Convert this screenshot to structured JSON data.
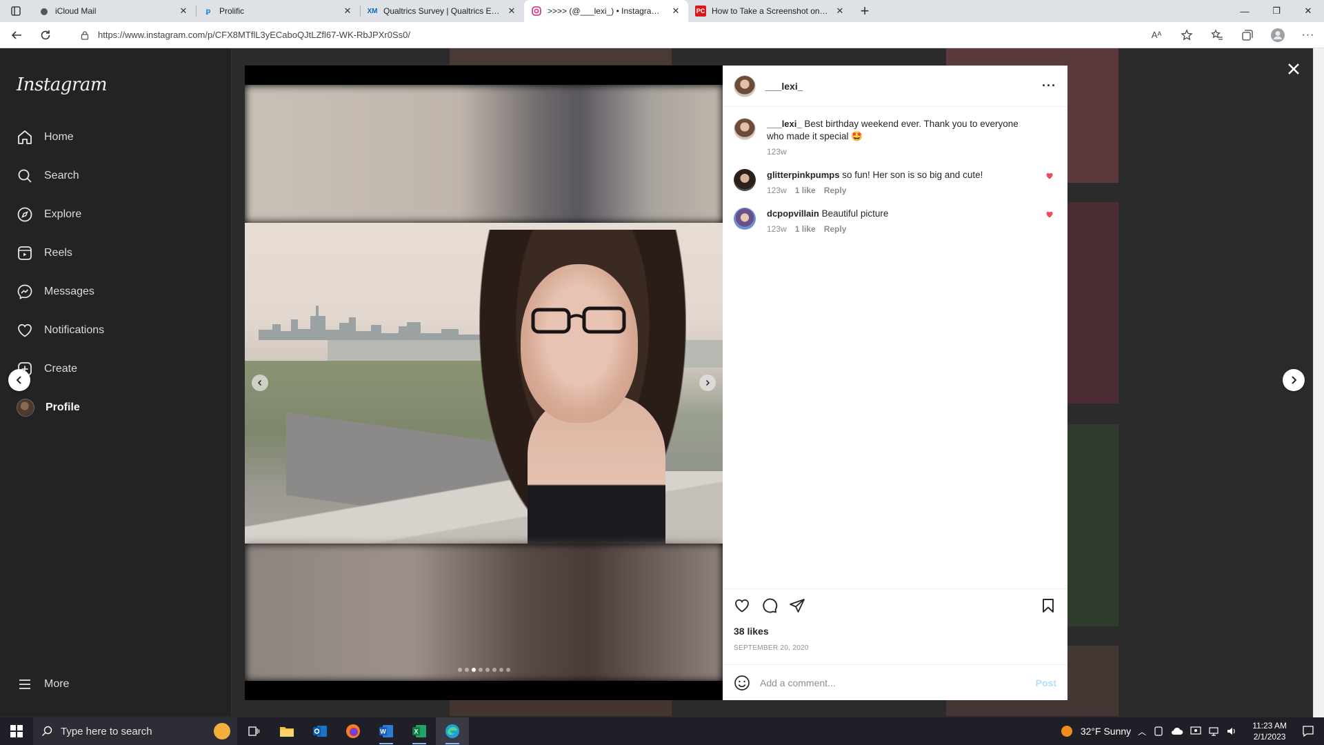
{
  "browser": {
    "tabs": [
      {
        "title": "iCloud Mail",
        "favicon": "apple-icon",
        "active": false
      },
      {
        "title": "Prolific",
        "favicon": "prolific-icon",
        "active": false
      },
      {
        "title": "Qualtrics Survey | Qualtrics Exper",
        "favicon": "qualtrics-icon",
        "favicon_text": "XM",
        "active": false
      },
      {
        "title": ">>>> (@___lexi_) • Instagram p",
        "favicon": "instagram-icon",
        "active": true
      },
      {
        "title": "How to Take a Screenshot on An",
        "favicon": "pcmag-icon",
        "favicon_text": "PC",
        "active": false
      }
    ],
    "url": "https://www.instagram.com/p/CFX8MTflL3yECaboQJtLZfl67-WK-RbJPXr0Ss0/"
  },
  "sidebar": {
    "logo": "Instagram",
    "items": [
      {
        "label": "Home",
        "icon": "home-icon"
      },
      {
        "label": "Search",
        "icon": "search-icon"
      },
      {
        "label": "Explore",
        "icon": "compass-icon"
      },
      {
        "label": "Reels",
        "icon": "reels-icon"
      },
      {
        "label": "Messages",
        "icon": "messenger-icon"
      },
      {
        "label": "Notifications",
        "icon": "heart-icon"
      },
      {
        "label": "Create",
        "icon": "plus-square-icon"
      },
      {
        "label": "Profile",
        "icon": "avatar"
      }
    ],
    "more": "More"
  },
  "post": {
    "username": "___lexi_",
    "caption": "Best birthday weekend ever. Thank you to everyone who made it special 🤩",
    "caption_time": "123w",
    "carousel": {
      "count": 8,
      "current": 3
    },
    "comments": [
      {
        "username": "glitterpinkpumps",
        "text": "so fun! Her son is so big and cute!",
        "time": "123w",
        "likes": "1 like",
        "reply": "Reply",
        "liked": true
      },
      {
        "username": "dcpopvillain",
        "text": "Beautiful picture",
        "time": "123w",
        "likes": "1 like",
        "reply": "Reply",
        "liked": true
      }
    ],
    "likes": "38 likes",
    "date": "SEPTEMBER 20, 2020",
    "comment_placeholder": "Add a comment...",
    "post_label": "Post"
  },
  "taskbar": {
    "search_placeholder": "Type here to search",
    "weather": "32°F  Sunny",
    "time": "11:23 AM",
    "date": "2/1/2023"
  },
  "colors": {
    "accent": "#0095f6",
    "like_red": "#ed4956",
    "post_disabled": "#b2dffc"
  }
}
